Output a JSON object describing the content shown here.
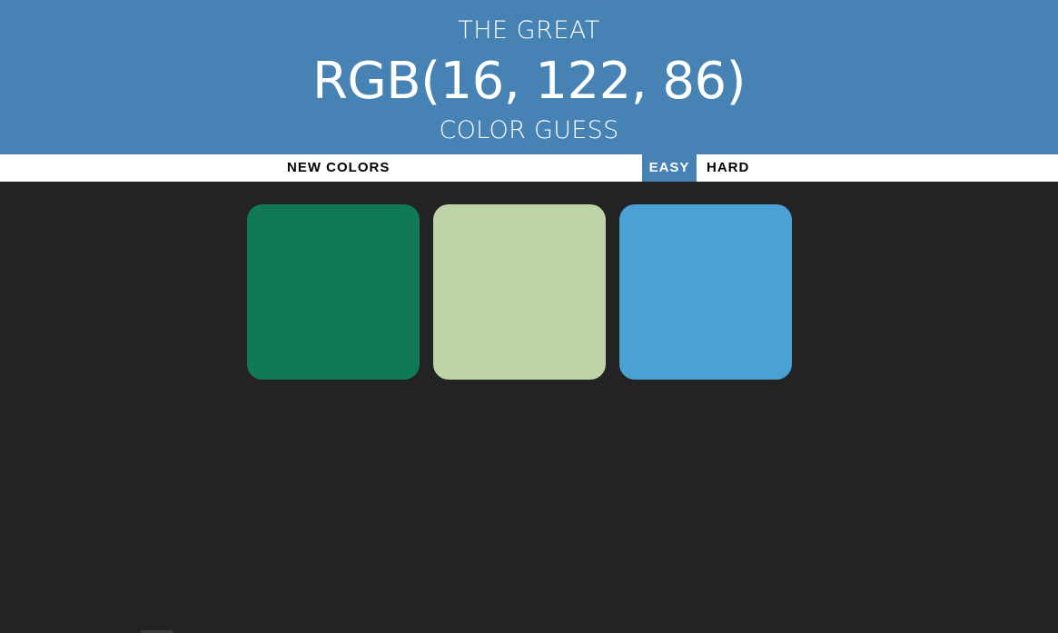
{
  "header": {
    "title_top": "THE GREAT",
    "color_display": "RGB(16, 122, 86)",
    "title_bottom": "COLOR GUESS",
    "background": "#4682b4"
  },
  "stripe": {
    "new_colors_label": "NEW COLORS",
    "message": "",
    "easy_label": "EASY",
    "hard_label": "HARD",
    "selected_mode": "EASY"
  },
  "squares": [
    {
      "color": "#107a56"
    },
    {
      "color": "#bcd4a7"
    },
    {
      "color": "#4aa1d4"
    }
  ],
  "page_background": "#232323"
}
